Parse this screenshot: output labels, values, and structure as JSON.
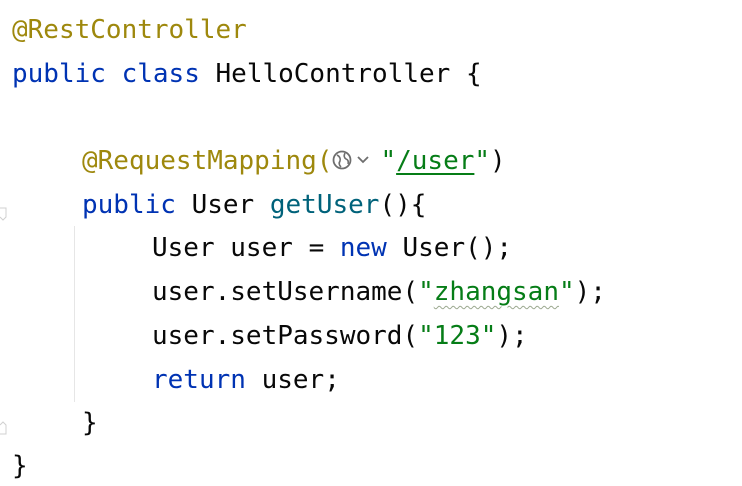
{
  "editor": {
    "language": "java",
    "lines": {
      "l1_annotation": "@RestController",
      "l2_public": "public",
      "l2_class": "class",
      "l2_name": "HelloController",
      "l2_brace": "{",
      "l4_annotation": "@RequestMapping(",
      "l4_quote_open": "\"",
      "l4_url": "/user",
      "l4_quote_close": "\"",
      "l4_close": ")",
      "l5_public": "public",
      "l5_type": "User",
      "l5_method": "getUser",
      "l5_rest": "(){",
      "l6_type": "User",
      "l6_var": "user",
      "l6_eq": "=",
      "l6_new": "new",
      "l6_call": "User();",
      "l7_call": "user.setUsername(",
      "l7_str_q1": "\"",
      "l7_str": "zhangsan",
      "l7_str_q2": "\"",
      "l7_end": ");",
      "l8_call": "user.setPassword(",
      "l8_str": "\"123\"",
      "l8_end": ");",
      "l9_return": "return",
      "l9_rest": "user;",
      "l10_brace": "}",
      "l11_brace": "}"
    },
    "colors": {
      "annotation": "#9e880d",
      "keyword": "#0033b3",
      "method": "#00627a",
      "string": "#067d17",
      "plain": "#080808"
    },
    "icons": {
      "mapping": "globe-icon",
      "mapping_menu": "chevron-down-icon"
    }
  }
}
